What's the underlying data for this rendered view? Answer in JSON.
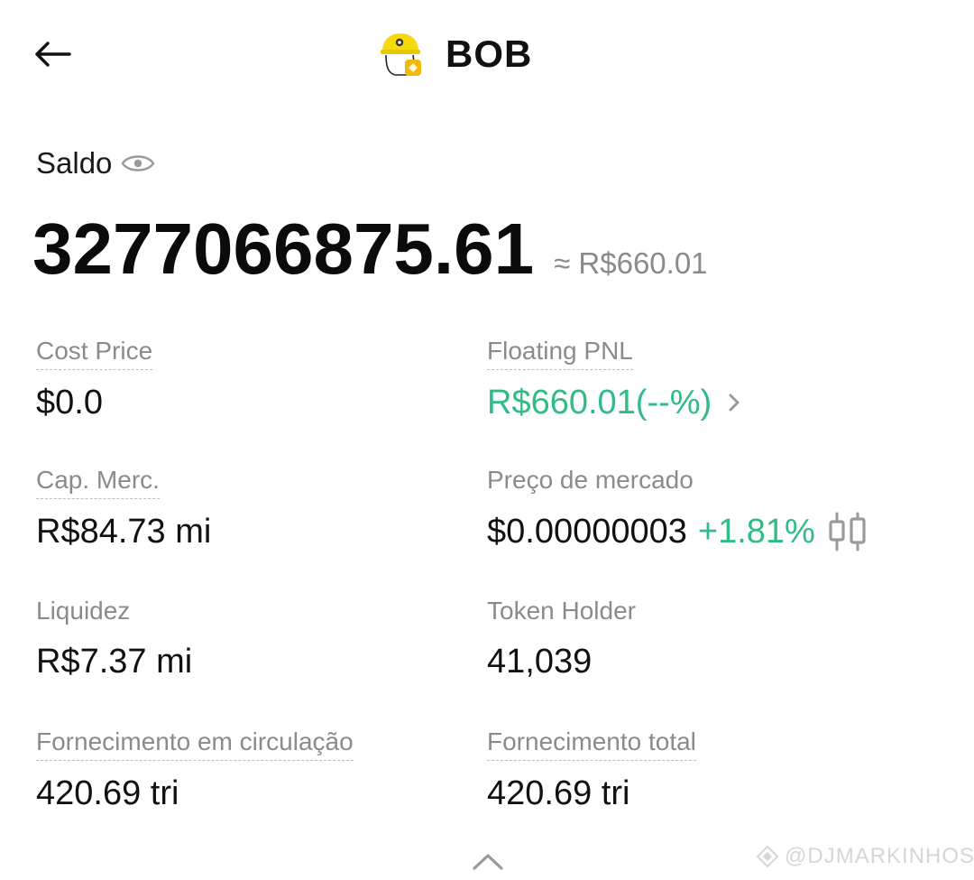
{
  "header": {
    "title": "BOB",
    "back_icon": "arrow-left-icon",
    "token_logo": "builder-helmet-logo"
  },
  "balance": {
    "label": "Saldo",
    "visibility_icon": "eye-icon",
    "amount": "3277066875.61",
    "fiat_approx": "≈ R$660.01"
  },
  "stats": {
    "cost_price": {
      "label": "Cost Price",
      "value": "$0.0"
    },
    "floating_pnl": {
      "label": "Floating PNL",
      "value": "R$660.01(--%)"
    },
    "market_cap": {
      "label": "Cap. Merc.",
      "value": "R$84.73 mi"
    },
    "market_price": {
      "label": "Preço de mercado",
      "value": "$0.00000003",
      "change": "+1.81%"
    },
    "liquidity": {
      "label": "Liquidez",
      "value": "R$7.37 mi"
    },
    "token_holder": {
      "label": "Token Holder",
      "value": "41,039"
    },
    "circulating_supply": {
      "label": "Fornecimento em circulação",
      "value": "420.69 tri"
    },
    "total_supply": {
      "label": "Fornecimento total",
      "value": "420.69 tri"
    }
  },
  "watermark": {
    "text": "@DJMARKINHOS"
  },
  "colors": {
    "positive": "#2fbd85",
    "muted": "#8b8b8b",
    "text": "#111111"
  }
}
